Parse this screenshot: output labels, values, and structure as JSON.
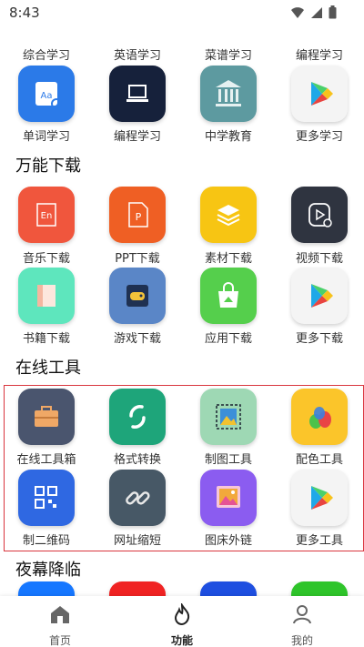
{
  "status_bar": {
    "time": "8:43"
  },
  "sections": {
    "study_top_row": [
      "综合学习",
      "英语学习",
      "菜谱学习",
      "编程学习"
    ],
    "study": [
      "单词学习",
      "编程学习",
      "中学教育",
      "更多学习"
    ],
    "download_title": "万能下载",
    "download_row1": [
      "音乐下载",
      "PPT下载",
      "素材下载",
      "视频下载"
    ],
    "download_row2": [
      "书籍下载",
      "游戏下载",
      "应用下载",
      "更多下载"
    ],
    "tools_title": "在线工具",
    "tools_row1": [
      "在线工具箱",
      "格式转换",
      "制图工具",
      "配色工具"
    ],
    "tools_row2": [
      "制二维码",
      "网址缩短",
      "图床外链",
      "更多工具"
    ],
    "night_title": "夜幕降临"
  },
  "bottom_nav": [
    "首页",
    "功能",
    "我的"
  ],
  "colors": {
    "accent_red": "#d9363e",
    "music": "#f0563d",
    "ppt": "#ef5f24",
    "material": "#f7c513",
    "video": "#2f3440",
    "book": "#5ee6bd",
    "game": "#5a86c7",
    "app": "#55cf4c",
    "toolbox": "#4a556e",
    "convert": "#1ea57a",
    "drawing": "#9ed8b4",
    "palette": "#fbc52a",
    "qrcode": "#2f68e2",
    "shortlink": "#475866",
    "imagehost": "#8b5cf0",
    "word": "#2b7ae8",
    "coding": "#16213b",
    "school": "#5d9aa0"
  }
}
